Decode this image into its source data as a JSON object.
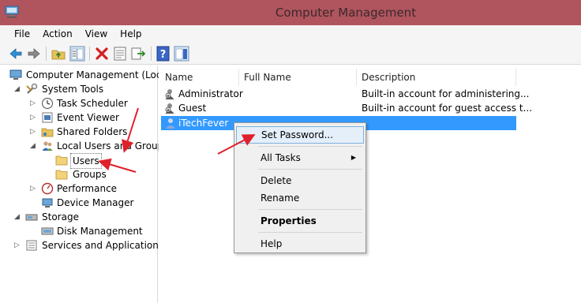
{
  "window": {
    "title": "Computer Management"
  },
  "menu": [
    "File",
    "Action",
    "View",
    "Help"
  ],
  "toolbar": {
    "icons": [
      "back-arrow-icon",
      "forward-arrow-icon",
      "up-folder-icon",
      "show-hide-tree-icon",
      "delete-icon",
      "properties-icon",
      "export-list-icon",
      "help-icon",
      "show-action-pane-icon"
    ]
  },
  "tree": {
    "root": "Computer Management (Local",
    "system_tools": "System Tools",
    "task_scheduler": "Task Scheduler",
    "event_viewer": "Event Viewer",
    "shared_folders": "Shared Folders",
    "local_users_groups": "Local Users and Groups",
    "users": "Users",
    "groups": "Groups",
    "performance": "Performance",
    "device_manager": "Device Manager",
    "storage": "Storage",
    "disk_management": "Disk Management",
    "services_apps": "Services and Applications"
  },
  "list": {
    "columns": [
      "Name",
      "Full Name",
      "Description"
    ],
    "rows": [
      {
        "name": "Administrator",
        "full_name": "",
        "description": "Built-in account for administering..."
      },
      {
        "name": "Guest",
        "full_name": "",
        "description": "Built-in account for guest access t..."
      },
      {
        "name": "iTechFever",
        "full_name": "",
        "description": ""
      }
    ]
  },
  "context_menu": {
    "set_password": "Set Password...",
    "all_tasks": "All Tasks",
    "delete": "Delete",
    "rename": "Rename",
    "properties": "Properties",
    "help": "Help"
  },
  "colors": {
    "titlebar": "#b0545e",
    "selection": "#3399ff",
    "annotation": "#e0202a"
  }
}
